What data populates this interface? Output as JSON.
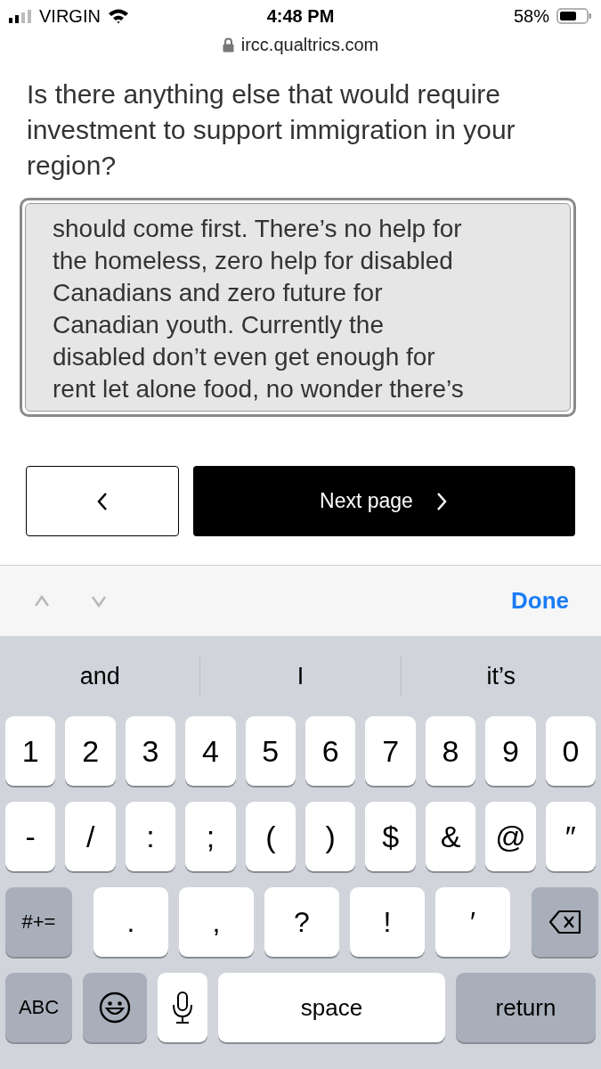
{
  "status_bar": {
    "carrier": "VIRGIN",
    "time": "4:48 PM",
    "battery": "58%"
  },
  "address_bar": {
    "url": "ircc.qualtrics.com"
  },
  "question": {
    "text": "Is there anything else that would require investment to support immigration in your region?"
  },
  "answer": {
    "value": "should come first. There’s no help for\nthe homeless, zero help for disabled\nCanadians and zero future for\nCanadian youth. Currently the\ndisabled don’t even get enough for\nrent let alone food, no wonder there’s"
  },
  "navigation": {
    "next_label": "Next page"
  },
  "keyboard_toolbar": {
    "done": "Done"
  },
  "suggestions": [
    "and",
    "I",
    "it’s"
  ],
  "keyboard_rows": [
    [
      {
        "kind": "char",
        "label": "1"
      },
      {
        "kind": "char",
        "label": "2"
      },
      {
        "kind": "char",
        "label": "3"
      },
      {
        "kind": "char",
        "label": "4"
      },
      {
        "kind": "char",
        "label": "5"
      },
      {
        "kind": "char",
        "label": "6"
      },
      {
        "kind": "char",
        "label": "7"
      },
      {
        "kind": "char",
        "label": "8"
      },
      {
        "kind": "char",
        "label": "9"
      },
      {
        "kind": "char",
        "label": "0"
      }
    ],
    [
      {
        "kind": "char",
        "label": "-"
      },
      {
        "kind": "char",
        "label": "/"
      },
      {
        "kind": "char",
        "label": ":"
      },
      {
        "kind": "char",
        "label": ";"
      },
      {
        "kind": "char",
        "label": "("
      },
      {
        "kind": "char",
        "label": ")"
      },
      {
        "kind": "char",
        "label": "$"
      },
      {
        "kind": "char",
        "label": "&"
      },
      {
        "kind": "char",
        "label": "@"
      },
      {
        "kind": "char",
        "label": "″"
      }
    ],
    [
      {
        "kind": "mode",
        "label": "#+="
      },
      {
        "kind": "punct",
        "label": "."
      },
      {
        "kind": "punct",
        "label": ","
      },
      {
        "kind": "punct",
        "label": "?"
      },
      {
        "kind": "punct",
        "label": "!"
      },
      {
        "kind": "punct",
        "label": "′"
      },
      {
        "kind": "delete"
      }
    ],
    [
      {
        "kind": "mode",
        "label": "ABC"
      },
      {
        "kind": "emoji"
      },
      {
        "kind": "mic"
      },
      {
        "kind": "space",
        "label": "space"
      },
      {
        "kind": "return",
        "label": "return"
      }
    ]
  ]
}
